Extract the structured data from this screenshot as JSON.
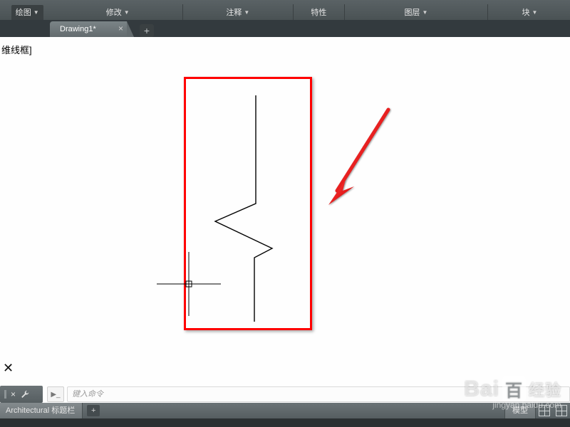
{
  "ribbon": {
    "panels": [
      {
        "name": "绘图"
      },
      {
        "name": "修改"
      },
      {
        "name": "注释"
      },
      {
        "name": "特性"
      },
      {
        "name": "图层"
      },
      {
        "name": "块"
      }
    ]
  },
  "tab": {
    "title": "Drawing1*"
  },
  "canvas": {
    "corner_label": "维线框]"
  },
  "command": {
    "placeholder": "键入命令"
  },
  "bottom": {
    "left_tab": "Architectural 标题栏",
    "model": "模型"
  },
  "watermark": {
    "brand_a": "Bai",
    "brand_b": "百",
    "brand_c": "经验",
    "url": "jingyan.baidu.com"
  }
}
